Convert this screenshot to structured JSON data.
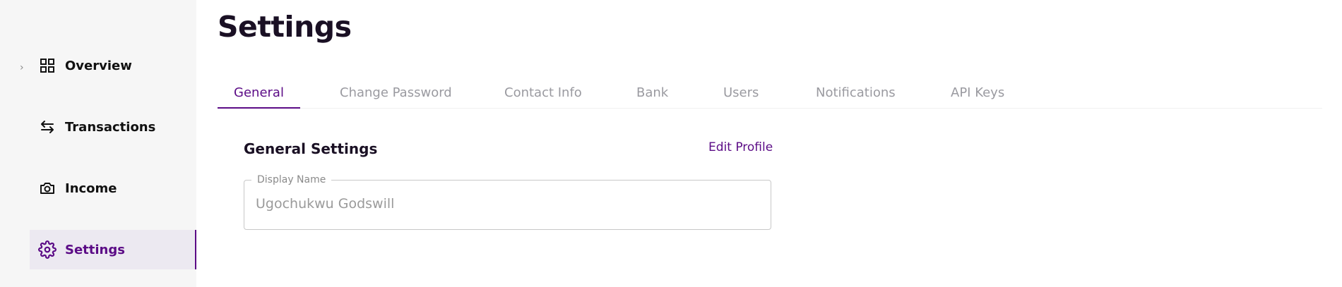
{
  "sidebar": {
    "items": [
      {
        "label": "Overview",
        "icon": "grid-icon",
        "active": false
      },
      {
        "label": "Transactions",
        "icon": "swap-arrows-icon",
        "active": false
      },
      {
        "label": "Income",
        "icon": "camera-icon",
        "active": false
      },
      {
        "label": "Settings",
        "icon": "gear-icon",
        "active": true
      }
    ],
    "expand_glyph": "›"
  },
  "page": {
    "title": "Settings"
  },
  "tabs": [
    {
      "label": "General",
      "active": true
    },
    {
      "label": "Change Password",
      "active": false
    },
    {
      "label": "Contact Info",
      "active": false
    },
    {
      "label": "Bank",
      "active": false
    },
    {
      "label": "Users",
      "active": false
    },
    {
      "label": "Notifications",
      "active": false
    },
    {
      "label": "API Keys",
      "active": false
    }
  ],
  "general": {
    "section_title": "General Settings",
    "edit_label": "Edit Profile",
    "display_name": {
      "label": "Display Name",
      "value": "Ugochukwu Godswill"
    }
  },
  "colors": {
    "accent": "#5b0b86",
    "sidebar_bg": "#f6f6f6",
    "active_bg": "#ece9f1",
    "tab_inactive": "#9a9aa0"
  }
}
